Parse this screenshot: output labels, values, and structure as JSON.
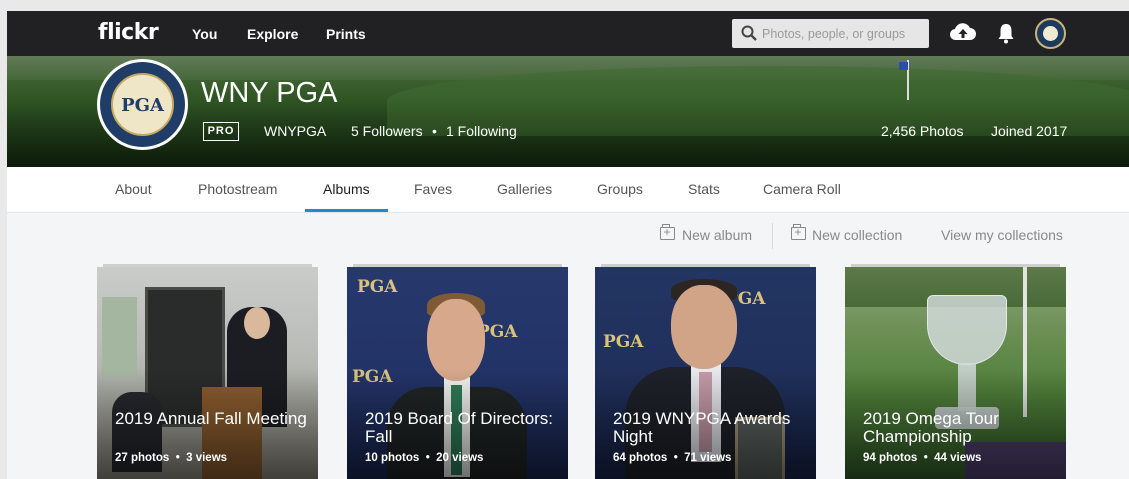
{
  "nav": {
    "logo": "flickr",
    "links": [
      "You",
      "Explore",
      "Prints"
    ],
    "search_placeholder": "Photos, people, or groups"
  },
  "profile": {
    "name": "WNY PGA",
    "badge": "PRO",
    "username": "WNYPGA",
    "followers": "5 Followers",
    "following": "1 Following",
    "photos": "2,456 Photos",
    "joined": "Joined 2017",
    "avatar_text": "PGA"
  },
  "tabs": [
    "About",
    "Photostream",
    "Albums",
    "Faves",
    "Galleries",
    "Groups",
    "Stats",
    "Camera Roll"
  ],
  "active_tab": "Albums",
  "actions": {
    "new_album": "New album",
    "new_collection": "New collection",
    "view_collections": "View my collections"
  },
  "albums": [
    {
      "title": "2019 Annual Fall Meeting",
      "photos": "27 photos",
      "views": "3 views"
    },
    {
      "title": "2019 Board Of Directors: Fall",
      "photos": "10 photos",
      "views": "20 views"
    },
    {
      "title": "2019 WNYPGA Awards Night",
      "photos": "64 photos",
      "views": "71 views"
    },
    {
      "title": "2019 Omega Tour Championship",
      "photos": "94 photos",
      "views": "44 views"
    }
  ],
  "colors": {
    "nav_bg": "#212124",
    "active_underline": "#1c8ad4",
    "page_bg": "#f3f5f6"
  },
  "icons": [
    "search-icon",
    "upload-cloud-icon",
    "bell-icon",
    "new-album-icon",
    "new-collection-icon"
  ]
}
